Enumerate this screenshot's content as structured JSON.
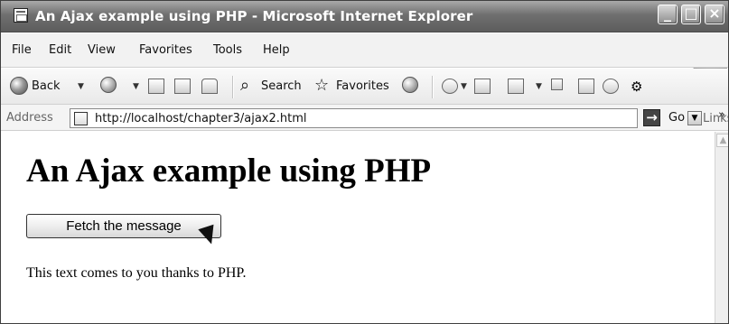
{
  "window": {
    "title": "An Ajax example using PHP - Microsoft Internet Explorer",
    "controls": {
      "minimize": "_",
      "maximize": "□",
      "close": "×"
    }
  },
  "menu": [
    "File",
    "Edit",
    "View",
    "Favorites",
    "Tools",
    "Help"
  ],
  "toolbar": {
    "back_label": "Back",
    "search_label": "Search",
    "favorites_label": "Favorites"
  },
  "address": {
    "label": "Address",
    "url": "http://localhost/chapter3/ajax2.html",
    "go_label": "Go",
    "links_label": "Links",
    "links_more": "»"
  },
  "page": {
    "heading": "An Ajax example using PHP",
    "button_label": "Fetch the message",
    "message": "This text comes to you thanks to PHP."
  },
  "icons": {
    "browser": "page-icon",
    "back": "back-icon",
    "forward": "forward-icon",
    "stop": "stop-icon",
    "refresh": "refresh-icon",
    "home": "home-icon",
    "search": "search-icon",
    "favorites": "favorites-star-icon",
    "history": "history-icon",
    "mail": "mail-icon",
    "print": "print-icon",
    "edit": "edit-icon",
    "discuss": "discuss-icon",
    "research": "research-icon",
    "messenger": "messenger-icon",
    "cursor": "mouse-pointer-icon"
  }
}
